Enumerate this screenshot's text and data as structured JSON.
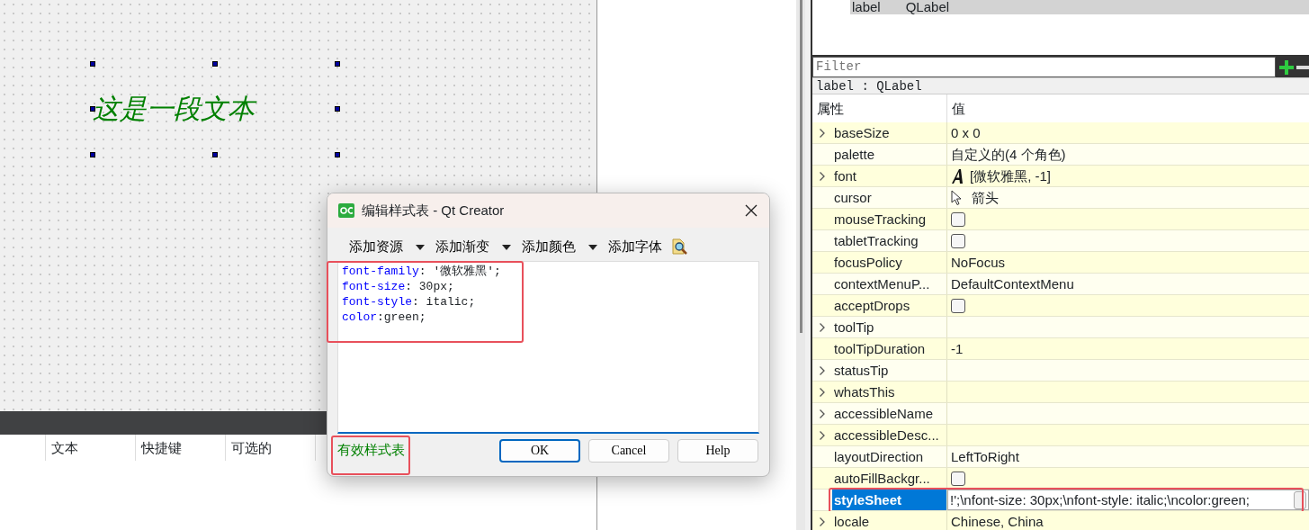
{
  "form_canvas": {
    "label_text": "这是一段文本"
  },
  "action_table": {
    "columns": [
      "文本",
      "快捷键",
      "可选的"
    ]
  },
  "object_inspector": {
    "rows": [
      {
        "object": "label",
        "class": "QLabel",
        "selected": true
      }
    ]
  },
  "property_editor": {
    "filter": {
      "placeholder": "Filter"
    },
    "object_title": "label : QLabel",
    "columns": [
      "属性",
      "值"
    ],
    "properties": [
      {
        "name": "baseSize",
        "expandable": true,
        "kind": "text",
        "value": "0 x 0",
        "selected": false,
        "highlighted": false
      },
      {
        "name": "palette",
        "expandable": false,
        "kind": "text",
        "value": "自定义的(4 个角色)",
        "selected": false,
        "highlighted": false
      },
      {
        "name": "font",
        "expandable": true,
        "kind": "font",
        "value": "[微软雅黑, -1]",
        "selected": false,
        "highlighted": false
      },
      {
        "name": "cursor",
        "expandable": false,
        "kind": "cursor",
        "value": "箭头",
        "selected": false,
        "highlighted": false
      },
      {
        "name": "mouseTracking",
        "expandable": false,
        "kind": "checkbox",
        "checked": false,
        "selected": false,
        "highlighted": false
      },
      {
        "name": "tabletTracking",
        "expandable": false,
        "kind": "checkbox",
        "checked": false,
        "selected": false,
        "highlighted": false
      },
      {
        "name": "focusPolicy",
        "expandable": false,
        "kind": "text",
        "value": "NoFocus",
        "selected": false,
        "highlighted": false
      },
      {
        "name": "contextMenuP...",
        "expandable": false,
        "kind": "text",
        "value": "DefaultContextMenu",
        "selected": false,
        "highlighted": false
      },
      {
        "name": "acceptDrops",
        "expandable": false,
        "kind": "checkbox",
        "checked": false,
        "selected": false,
        "highlighted": false
      },
      {
        "name": "toolTip",
        "expandable": true,
        "kind": "empty",
        "selected": false,
        "highlighted": false
      },
      {
        "name": "toolTipDuration",
        "expandable": false,
        "kind": "text",
        "value": "-1",
        "selected": false,
        "highlighted": false
      },
      {
        "name": "statusTip",
        "expandable": true,
        "kind": "empty",
        "selected": false,
        "highlighted": false
      },
      {
        "name": "whatsThis",
        "expandable": true,
        "kind": "empty",
        "selected": false,
        "highlighted": false
      },
      {
        "name": "accessibleName",
        "expandable": true,
        "kind": "empty",
        "selected": false,
        "highlighted": false
      },
      {
        "name": "accessibleDesc...",
        "expandable": true,
        "kind": "empty",
        "selected": false,
        "highlighted": false
      },
      {
        "name": "layoutDirection",
        "expandable": false,
        "kind": "text",
        "value": "LeftToRight",
        "selected": false,
        "highlighted": false
      },
      {
        "name": "autoFillBackgr...",
        "expandable": false,
        "kind": "checkbox",
        "checked": false,
        "selected": false,
        "highlighted": false
      },
      {
        "name": "styleSheet",
        "expandable": false,
        "kind": "editor",
        "value": "!';\\nfont-size: 30px;\\nfont-style: italic;\\ncolor:green;",
        "selected": true,
        "highlighted": true
      },
      {
        "name": "locale",
        "expandable": true,
        "kind": "text",
        "value": "Chinese, China",
        "selected": false,
        "highlighted": false
      }
    ]
  },
  "dialog": {
    "title": "编辑样式表 - Qt Creator",
    "toolbar": [
      {
        "label": "添加资源",
        "dropdown": true
      },
      {
        "label": "添加渐变",
        "dropdown": true
      },
      {
        "label": "添加颜色",
        "dropdown": true
      },
      {
        "label": "添加字体",
        "dropdown": false
      }
    ],
    "editor_highlighted": true,
    "code_lines": [
      {
        "property": "font-family",
        "rest": ": '微软雅黑';"
      },
      {
        "property": "font-size",
        "rest": ": 30px;"
      },
      {
        "property": "font-style",
        "rest": ": italic;"
      },
      {
        "property": "color",
        "rest": ":green;"
      }
    ],
    "status": {
      "text": "有效样式表",
      "highlighted": true
    },
    "buttons": [
      {
        "label": "OK",
        "default": true
      },
      {
        "label": "Cancel",
        "default": false
      },
      {
        "label": "Help",
        "default": false
      }
    ]
  }
}
